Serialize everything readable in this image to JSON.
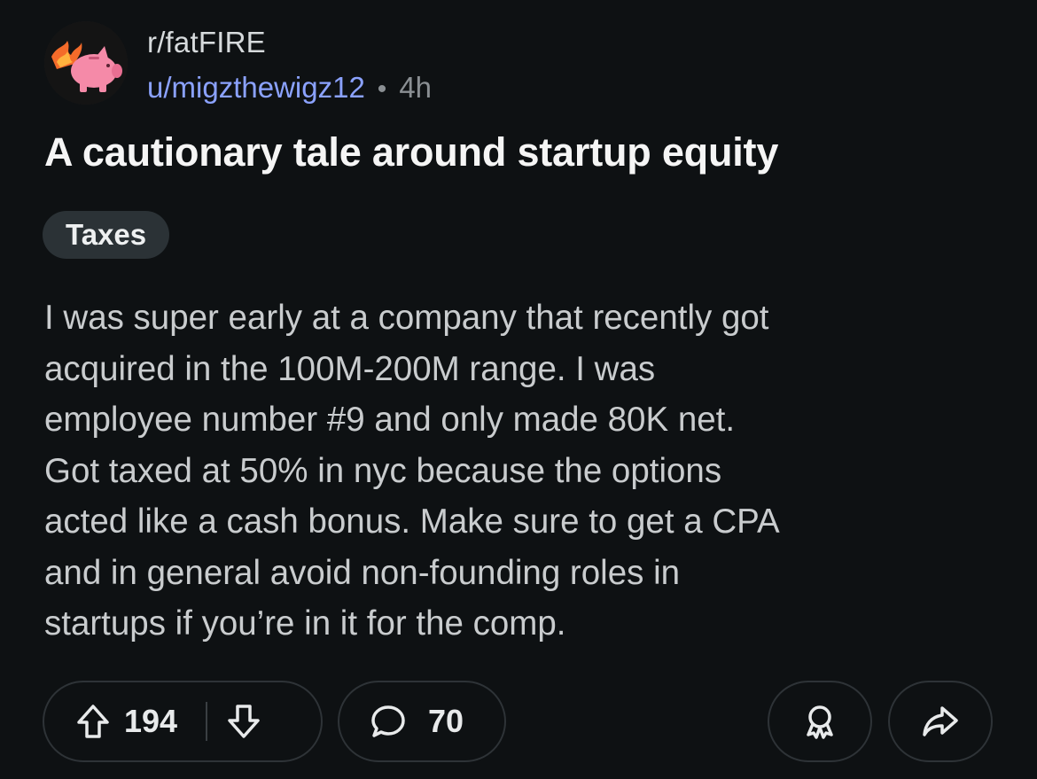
{
  "post": {
    "subreddit": "r/fatFIRE",
    "author": "u/migzthewigz12",
    "separator": "•",
    "age": "4h",
    "title": "A cautionary tale around startup equity",
    "flair": "Taxes",
    "body": "I was super early at a company that recently got\nacquired in the 100M-200M range. I was\nemployee number #9 and only made 80K net.\nGot taxed at 50% in nyc because the options\nacted like a cash bonus. Make sure to get a CPA\nand in general avoid non-founding roles in\nstartups if you’re in it for the comp."
  },
  "actions": {
    "upvote_icon": "arrow-up-icon",
    "score": "194",
    "downvote_icon": "arrow-down-icon",
    "comment_icon": "speech-bubble-icon",
    "comments": "70",
    "award_icon": "award-icon",
    "share_icon": "share-arrow-icon"
  },
  "colors": {
    "background": "#0e1113",
    "author_link": "#8ba2ff",
    "flair_background": "#2b3236",
    "avatar_pig": "#f58aa8",
    "avatar_flame": "#f46b2a"
  }
}
